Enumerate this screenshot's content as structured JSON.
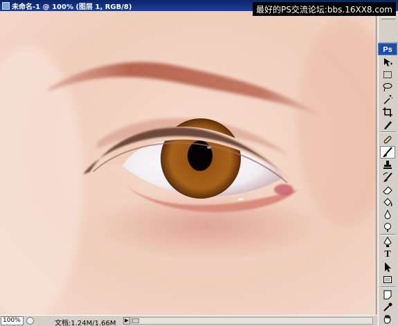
{
  "window": {
    "title": "未命名-1 @ 100% (图层 1, RGB/8)",
    "watermark": "最好的PS交流论坛:bbs.16XX8.com"
  },
  "toolbox": {
    "logo": "Ps",
    "type_tool_glyph": "T",
    "tools": [
      {
        "name": "move-tool",
        "icon": "move-icon"
      },
      {
        "name": "marquee-tool",
        "icon": "marquee-icon"
      },
      {
        "name": "lasso-tool",
        "icon": "lasso-icon"
      },
      {
        "name": "magic-wand-tool",
        "icon": "magic-wand-icon"
      },
      {
        "name": "crop-tool",
        "icon": "crop-icon"
      },
      {
        "name": "slice-tool",
        "icon": "slice-icon"
      },
      {
        "name": "healing-brush-tool",
        "icon": "bandage-icon"
      },
      {
        "name": "brush-tool",
        "icon": "brush-icon",
        "active": true
      },
      {
        "name": "clone-stamp-tool",
        "icon": "stamp-icon"
      },
      {
        "name": "history-brush-tool",
        "icon": "history-brush-icon"
      },
      {
        "name": "eraser-tool",
        "icon": "eraser-icon"
      },
      {
        "name": "paint-bucket-tool",
        "icon": "bucket-icon"
      },
      {
        "name": "blur-tool",
        "icon": "blur-icon"
      },
      {
        "name": "dodge-tool",
        "icon": "dodge-icon"
      },
      {
        "name": "pen-tool",
        "icon": "pen-icon"
      },
      {
        "name": "type-tool",
        "icon": "type-icon"
      },
      {
        "name": "path-selection-tool",
        "icon": "arrow-icon"
      },
      {
        "name": "shape-tool",
        "icon": "rectangle-icon"
      },
      {
        "name": "notes-tool",
        "icon": "notes-icon"
      },
      {
        "name": "eyedropper-tool",
        "icon": "eyedropper-icon"
      },
      {
        "name": "hand-tool",
        "icon": "hand-icon"
      },
      {
        "name": "zoom-tool",
        "icon": "zoom-icon"
      }
    ]
  },
  "statusbar": {
    "zoom": "100%",
    "doc_size": "文档:1.24M/1.66M"
  },
  "colors": {
    "titlebar": "#0a246a",
    "skin": "#f2d3c4",
    "iris": "#8a4a12",
    "brow": "#c0705a"
  }
}
